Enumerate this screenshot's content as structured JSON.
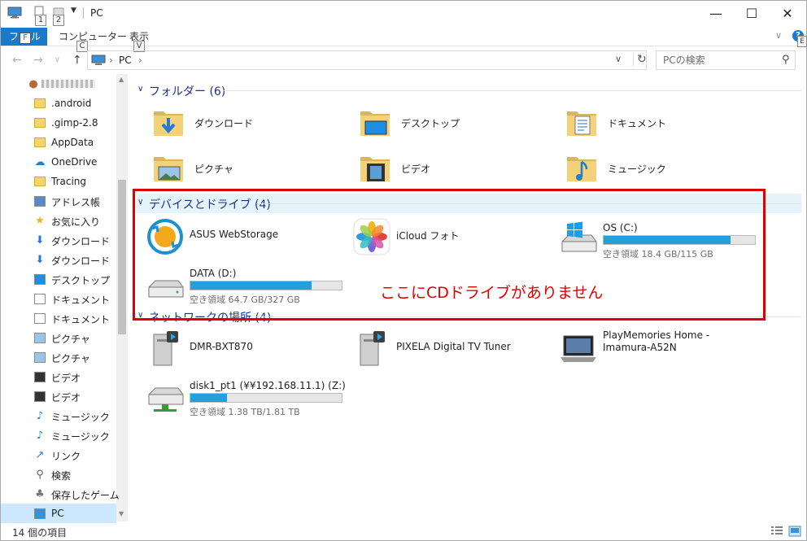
{
  "window": {
    "title": "PC"
  },
  "quick_access": {
    "key1": "1",
    "key2": "2"
  },
  "ribbon": {
    "file_label": "フ",
    "file_key": "F",
    "file_tail": "ル",
    "computer_label": "コンピューター",
    "computer_key": "C",
    "view_label": "表示",
    "view_key": "V",
    "help_label": "?",
    "help_key": "E"
  },
  "address": {
    "crumbs": [
      "PC"
    ],
    "search_placeholder": "PCの検索"
  },
  "sidebar": {
    "items": [
      {
        "label": "",
        "icon": "user-icon"
      },
      {
        "label": ".android",
        "icon": "folder-icon"
      },
      {
        "label": ".gimp-2.8",
        "icon": "folder-icon"
      },
      {
        "label": "AppData",
        "icon": "folder-icon"
      },
      {
        "label": "OneDrive",
        "icon": "onedrive-icon"
      },
      {
        "label": "Tracing",
        "icon": "folder-icon"
      },
      {
        "label": "アドレス帳",
        "icon": "contacts-icon"
      },
      {
        "label": "お気に入り",
        "icon": "favorites-icon"
      },
      {
        "label": "ダウンロード",
        "icon": "download-icon"
      },
      {
        "label": "ダウンロード",
        "icon": "download-icon"
      },
      {
        "label": "デスクトップ",
        "icon": "desktop-icon"
      },
      {
        "label": "ドキュメント",
        "icon": "documents-icon"
      },
      {
        "label": "ドキュメント",
        "icon": "documents-icon"
      },
      {
        "label": "ピクチャ",
        "icon": "pictures-icon"
      },
      {
        "label": "ピクチャ",
        "icon": "pictures-icon"
      },
      {
        "label": "ビデオ",
        "icon": "video-icon"
      },
      {
        "label": "ビデオ",
        "icon": "video-icon"
      },
      {
        "label": "ミュージック",
        "icon": "music-icon"
      },
      {
        "label": "ミュージック",
        "icon": "music-icon"
      },
      {
        "label": "リンク",
        "icon": "links-icon"
      },
      {
        "label": "検索",
        "icon": "search-icon"
      },
      {
        "label": "保存したゲーム",
        "icon": "games-icon"
      },
      {
        "label": "PC",
        "icon": "pc-icon"
      }
    ]
  },
  "groups": {
    "folders": {
      "header": "フォルダー (6)",
      "items": [
        {
          "label": "ダウンロード",
          "icon": "downloads-folder-icon"
        },
        {
          "label": "デスクトップ",
          "icon": "desktop-folder-icon"
        },
        {
          "label": "ドキュメント",
          "icon": "documents-folder-icon"
        },
        {
          "label": "ピクチャ",
          "icon": "pictures-folder-icon"
        },
        {
          "label": "ビデオ",
          "icon": "videos-folder-icon"
        },
        {
          "label": "ミュージック",
          "icon": "music-folder-icon"
        }
      ]
    },
    "devices": {
      "header": "デバイスとドライブ (4)",
      "items": [
        {
          "label": "ASUS WebStorage",
          "icon": "asus-webstorage-icon"
        },
        {
          "label": "iCloud フォト",
          "icon": "icloud-photos-icon"
        },
        {
          "label": "OS (C:)",
          "icon": "windows-drive-icon",
          "free": "空き領域 18.4 GB/115 GB",
          "used_fraction": 0.84
        },
        {
          "label": "DATA (D:)",
          "icon": "hard-drive-icon",
          "free": "空き領域 64.7 GB/327 GB",
          "used_fraction": 0.8
        }
      ]
    },
    "network": {
      "header": "ネットワークの場所 (4)",
      "items": [
        {
          "label": "DMR-BXT870",
          "icon": "media-server-icon"
        },
        {
          "label": "PIXELA Digital TV Tuner",
          "icon": "media-server-icon"
        },
        {
          "label": "PlayMemories Home -\nImamura-A52N",
          "label_line1": "PlayMemories Home -",
          "label_line2": "Imamura-A52N",
          "icon": "laptop-icon"
        },
        {
          "label": "disk1_pt1 (¥¥192.168.11.1) (Z:)",
          "icon": "network-drive-icon",
          "free": "空き領域 1.38 TB/1.81 TB",
          "used_fraction": 0.24
        }
      ]
    }
  },
  "annotation": {
    "text": "ここにCDドライブがありません"
  },
  "status": {
    "text": "14 個の項目"
  },
  "colors": {
    "accent": "#1979ca",
    "bar_fill": "#26a0da",
    "annotation": "#e00000",
    "group_header": "#1e3287",
    "selection": "#cce8ff"
  }
}
